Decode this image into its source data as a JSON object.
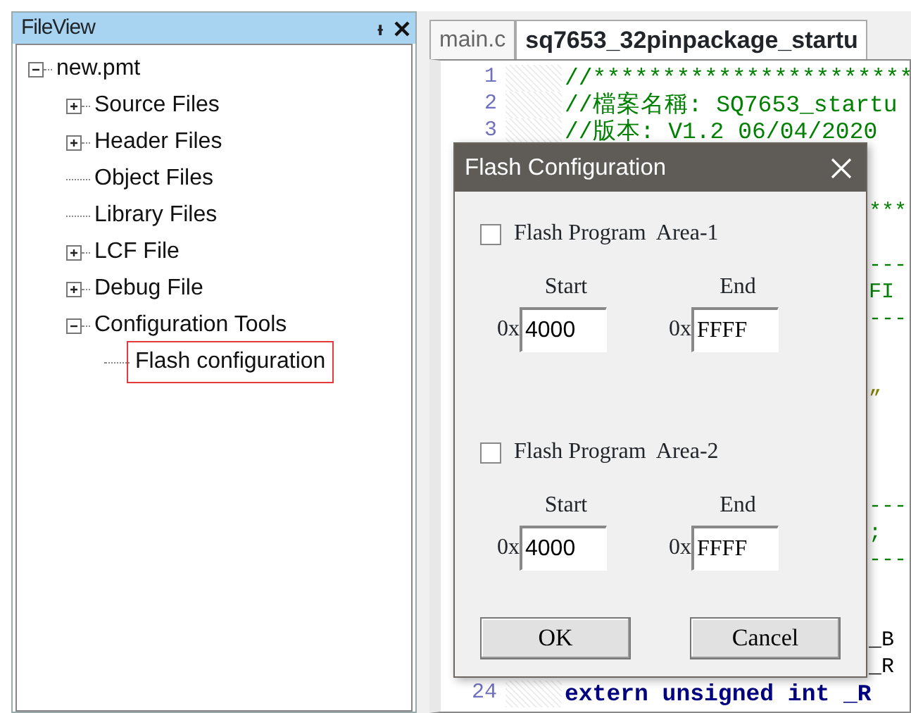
{
  "file_view": {
    "title": "FileView",
    "pin_glyph": "ᵻ",
    "tree": [
      {
        "label": "new.pmt",
        "expanded": true,
        "children": [
          {
            "label": "Source Files",
            "expanded": false
          },
          {
            "label": "Header Files",
            "expanded": false
          },
          {
            "label": "Object Files"
          },
          {
            "label": "Library Files"
          },
          {
            "label": "LCF File",
            "expanded": false
          },
          {
            "label": "Debug File",
            "expanded": false
          },
          {
            "label": "Configuration Tools",
            "expanded": true,
            "children": [
              {
                "label": "Flash configuration",
                "highlighted": true
              }
            ]
          }
        ]
      }
    ]
  },
  "tabs": [
    {
      "label": "main.c",
      "selected": false
    },
    {
      "label": "sq7653_32pinpackage_startu",
      "selected": true
    }
  ],
  "editor": {
    "lines": [
      {
        "kind": "code",
        "number": "1",
        "text": "//***********************",
        "color": "#008000"
      },
      {
        "kind": "code",
        "number": "2",
        "text": "//檔案名稱: SQ7653_startu",
        "color": "#008000"
      },
      {
        "kind": "code",
        "number": "3",
        "text": "//版本: V1.2 06/04/2020",
        "color": "#008000"
      },
      {
        "kind": "blank"
      },
      {
        "kind": "blank"
      },
      {
        "kind": "tail",
        "text": "***",
        "color": "#008000"
      },
      {
        "kind": "blank"
      },
      {
        "kind": "tail",
        "text": "---",
        "color": "#008000"
      },
      {
        "kind": "tail",
        "text": "FI",
        "color": "#008000"
      },
      {
        "kind": "tail",
        "text": "---",
        "color": "#008000"
      },
      {
        "kind": "blank"
      },
      {
        "kind": "blank"
      },
      {
        "kind": "tail",
        "text": "”",
        "color": "#808000"
      },
      {
        "kind": "blank"
      },
      {
        "kind": "blank"
      },
      {
        "kind": "blank"
      },
      {
        "kind": "tail",
        "text": "---",
        "color": "#008000"
      },
      {
        "kind": "tail",
        "text": ";",
        "color": "#008000"
      },
      {
        "kind": "tail",
        "text": "---",
        "color": "#008000"
      },
      {
        "kind": "blank"
      },
      {
        "kind": "blank"
      },
      {
        "kind": "tail",
        "text": "_B",
        "color": "#000000"
      },
      {
        "kind": "tail",
        "text": "_R",
        "color": "#000000"
      },
      {
        "kind": "code",
        "number": "24",
        "text": "extern unsigned int _R",
        "color": "#000080"
      }
    ]
  },
  "dialog": {
    "title": "Flash Configuration",
    "areas": [
      {
        "label": "Flash Program  Area-1",
        "checked": false,
        "start_label": "Start",
        "start_prefix": "0x",
        "start_value": "4000",
        "end_label": "End",
        "end_prefix": "0x",
        "end_value": "FFFF"
      },
      {
        "label": "Flash Program  Area-2",
        "checked": false,
        "start_label": "Start",
        "start_prefix": "0x",
        "start_value": "4000",
        "end_label": "End",
        "end_prefix": "0x",
        "end_value": "FFFF"
      }
    ],
    "buttons": [
      "OK",
      "Cancel"
    ]
  }
}
